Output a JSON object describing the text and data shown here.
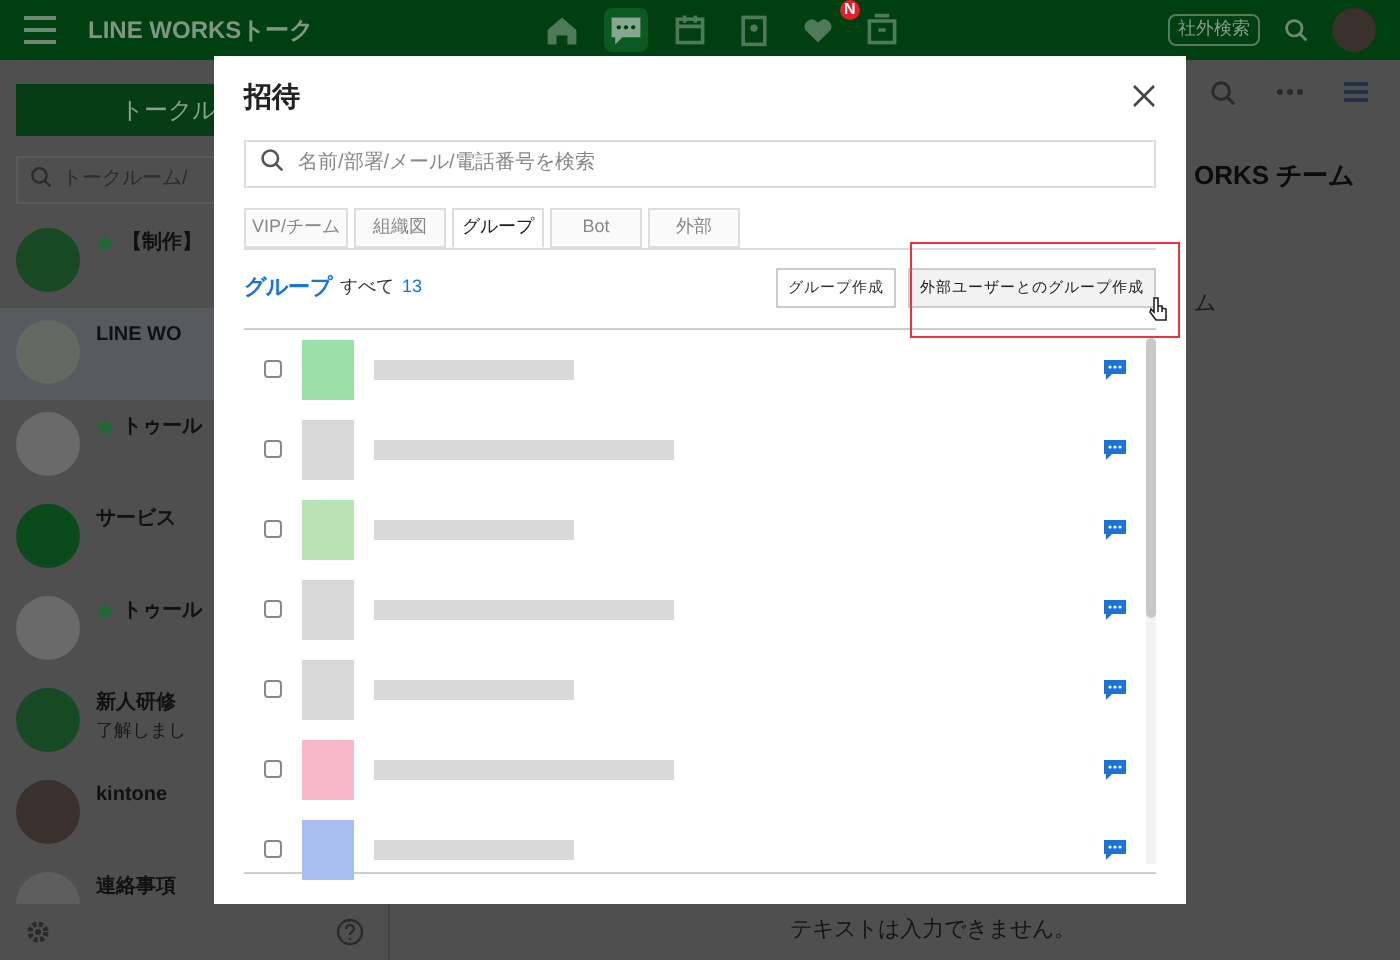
{
  "header": {
    "title": "LINE WORKSトーク",
    "nav": [
      {
        "kind": "home",
        "selected": false
      },
      {
        "kind": "talk",
        "selected": true
      },
      {
        "kind": "calendar",
        "selected": false
      },
      {
        "kind": "contacts",
        "selected": false
      },
      {
        "kind": "heart",
        "selected": false,
        "badge": "N"
      },
      {
        "kind": "box",
        "selected": false
      }
    ],
    "external_search": "社外検索"
  },
  "sidebar": {
    "new_button": "トークル",
    "search": {
      "placeholder": "トークルーム/"
    },
    "rooms": [
      {
        "kind": "logo",
        "name": "【制作】",
        "star": true,
        "color": "#174a24"
      },
      {
        "kind": "w",
        "name": "LINE WO",
        "star": false,
        "color": "#626a62"
      },
      {
        "kind": "person",
        "name": "トゥール",
        "star": true,
        "color": "#6a6a6a"
      },
      {
        "kind": "bell",
        "name": "サービス",
        "star": false,
        "color": "#0b4a1a"
      },
      {
        "kind": "person",
        "name": "トゥール",
        "star": true,
        "color": "#6a6a6a"
      },
      {
        "kind": "logo",
        "name": "新人研修",
        "preview": "了解しまし",
        "star": false,
        "color": "#174a24"
      },
      {
        "kind": "photo",
        "name": "kintone",
        "star": false,
        "color": "#3a302c"
      },
      {
        "kind": "photo",
        "name": "連絡事項",
        "star": false,
        "color": "#5e5e5e"
      }
    ]
  },
  "chat": {
    "title": "ORKS チーム",
    "line": "ム",
    "input_placeholder": "テキストは入力できません。"
  },
  "dialog": {
    "title": "招待",
    "search": {
      "placeholder": "名前/部署/メール/電話番号を検索"
    },
    "tabs": [
      {
        "label": "VIP/チーム",
        "selected": false
      },
      {
        "label": "組織図",
        "selected": false
      },
      {
        "label": "グループ",
        "selected": true
      },
      {
        "label": "Bot",
        "selected": false
      },
      {
        "label": "外部",
        "selected": false
      }
    ],
    "section": {
      "label": "グループ",
      "all": "すべて",
      "count": "13"
    },
    "buttons": [
      "グループ作成",
      "外部ユーザーとのグループ作成"
    ],
    "rows": [
      {
        "checked": false,
        "color": "#9be0a8"
      },
      {
        "checked": false,
        "color": "#d8d8d8"
      },
      {
        "checked": false,
        "color": "#b9e3b5"
      },
      {
        "checked": false,
        "color": "#d8d8d8"
      },
      {
        "checked": false,
        "color": "#d8d8d8"
      },
      {
        "checked": false,
        "color": "#f7b7c8"
      },
      {
        "checked": false,
        "color": "#a9bdf2"
      }
    ]
  }
}
